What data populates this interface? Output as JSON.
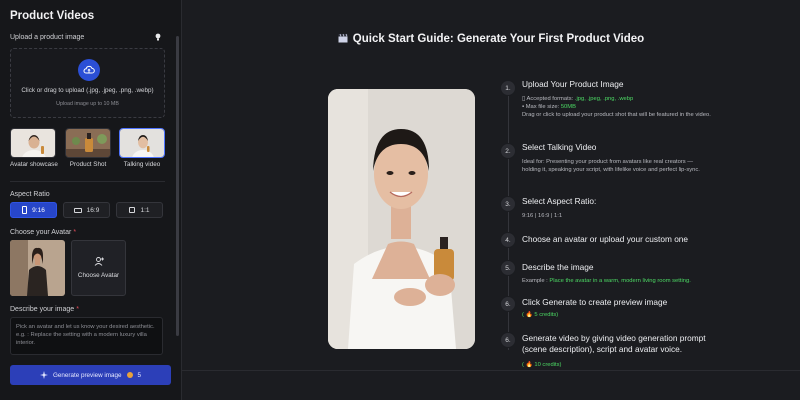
{
  "left": {
    "title": "Product Videos",
    "upload_label": "Upload a product image",
    "upload_text": "Click or drag to upload (.jpg, .jpeg, .png, .webp)",
    "upload_sub": "Upload image up to 10 MB",
    "modes": [
      {
        "label": "Avatar showcase",
        "icon": "avatar-showcase-thumb",
        "selected": false
      },
      {
        "label": "Product Shot",
        "icon": "product-shot-thumb",
        "selected": false
      },
      {
        "label": "Talking video",
        "icon": "talking-video-thumb",
        "selected": true
      }
    ],
    "aspect_label": "Aspect Ratio",
    "aspect_options": [
      {
        "label": "9:16",
        "active": true
      },
      {
        "label": "16:9",
        "active": false
      },
      {
        "label": "1:1",
        "active": false
      }
    ],
    "avatar_label": "Choose your Avatar",
    "avatar_required": "*",
    "choose_avatar": "Choose Avatar",
    "describe_label": "Describe your image",
    "describe_required": "*",
    "describe_placeholder": "Pick an avatar and let us know your desired aesthetic. e.g. : Replace the setting with a modern luxury villa interior.",
    "generate_label": "Generate preview image",
    "generate_credits": "5"
  },
  "main": {
    "title": "Quick Start Guide: Generate Your First Product Video",
    "steps": [
      {
        "num": "1.",
        "title": "Upload Your Product Image",
        "formats_label": "Accepted formats:",
        "formats": ".jpg, .jpeg, .png, .webp",
        "size_label": "Max file size:",
        "size": "50MB",
        "text": "Drag or click to upload your product shot that will be featured in the video."
      },
      {
        "num": "2.",
        "title": "Select Talking Video",
        "text": "Ideal for: Presenting your product from avatars like real creators — holding it, speaking your script, with lifelike voice and perfect lip-sync."
      },
      {
        "num": "3.",
        "title": "Select Aspect Ratio:",
        "text": "9:16 | 16:9 | 1:1"
      },
      {
        "num": "4.",
        "title": "Choose an avatar or upload your custom one"
      },
      {
        "num": "5.",
        "title": "Describe the image",
        "example_label": "Example :",
        "example": "Place the avatar in a warm, modern living room setting."
      },
      {
        "num": "6.",
        "title": "Click Generate to create preview image",
        "credits": "( 🔥 5 credits)"
      },
      {
        "num": "6.",
        "title": "Generate video by giving video generation prompt (scene description), script and avatar voice.",
        "credits": "( 🔥 10 credits)"
      }
    ]
  },
  "colors": {
    "accent": "#2c3fb8",
    "active": "#2746c9",
    "green": "#4cd964",
    "required": "#e24b5a"
  }
}
